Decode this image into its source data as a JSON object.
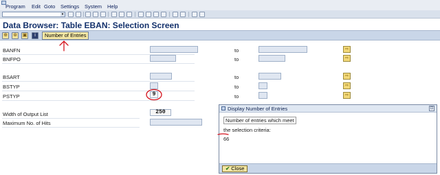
{
  "menubar": {
    "items": [
      "Program",
      "Edit",
      "Goto",
      "Settings",
      "System",
      "Help"
    ]
  },
  "page": {
    "title": "Data Browser: Table EBAN: Selection Screen"
  },
  "app_toolbar": {
    "number_of_entries_label": "Number of Entries"
  },
  "selection": {
    "fields": [
      {
        "label": "BANFN",
        "to_label": "to",
        "value": ""
      },
      {
        "label": "BNFPO",
        "to_label": "to",
        "value": ""
      },
      {
        "label": "BSART",
        "to_label": "to",
        "value": ""
      },
      {
        "label": "BSTYP",
        "to_label": "to",
        "value": ""
      },
      {
        "label": "PSTYP",
        "to_label": "to",
        "value": "9"
      }
    ],
    "width_of_output_list_label": "Width of Output List",
    "width_of_output_list_value": "250",
    "max_hits_label": "Maximum No. of Hits",
    "max_hits_value": ""
  },
  "dialog": {
    "title": "Display Number of Entries",
    "line1": "Number of entries which meet",
    "line2": "the selection criteria:",
    "count": "66",
    "close_label": "Close"
  },
  "colors": {
    "title": "#12306b",
    "annotation": "#d4101a",
    "toolbar": "#c9d6e8"
  }
}
